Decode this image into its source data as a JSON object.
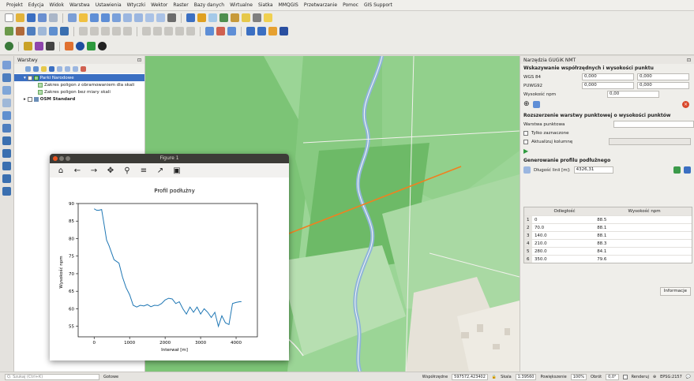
{
  "menubar": [
    "Projekt",
    "Edycja",
    "Widok",
    "Warstwa",
    "Ustawienia",
    "Wtyczki",
    "Wektor",
    "Raster",
    "Bazy danych",
    "Wirtualne",
    "Siatka",
    "MMQGIS",
    "Przetwarzanie",
    "Pomoc",
    "GIS Support"
  ],
  "layers_panel": {
    "title": "Warstwy",
    "items": [
      {
        "label": "Parki Narodowe",
        "selected": true
      },
      {
        "label": "Zakres poligon z obramowaniem dla skali",
        "selected": false
      },
      {
        "label": "Zakres poligon bez miary skali",
        "selected": false
      },
      {
        "label": "OSM Standard",
        "selected": false
      }
    ]
  },
  "figure": {
    "title": "Figure 1",
    "toolbar_icons": [
      "home-icon",
      "back-icon",
      "forward-icon",
      "pan-icon",
      "zoom-icon",
      "configure-icon",
      "edit-axis-icon",
      "save-icon"
    ]
  },
  "chart_data": {
    "type": "line",
    "title": "Profil podłużny",
    "xlabel": "Interwał [m]",
    "ylabel": "Wysokość npm",
    "xlim": [
      -450,
      4600
    ],
    "ylim": [
      52,
      90
    ],
    "xticks": [
      0,
      1000,
      2000,
      3000,
      4000
    ],
    "yticks": [
      55,
      60,
      65,
      70,
      75,
      80,
      85,
      90
    ],
    "series": [
      {
        "color": "#1f77b4",
        "x": [
          0,
          70,
          140,
          210,
          280,
          350,
          420,
          560,
          700,
          800,
          900,
          1000,
          1100,
          1200,
          1300,
          1400,
          1500,
          1600,
          1700,
          1800,
          1900,
          2000,
          2100,
          2200,
          2300,
          2400,
          2500,
          2600,
          2700,
          2800,
          2900,
          3000,
          3100,
          3200,
          3300,
          3400,
          3500,
          3600,
          3700,
          3800,
          3900,
          4000,
          4100,
          4150
        ],
        "y": [
          88.5,
          88.1,
          88.1,
          88.3,
          84.1,
          79.6,
          78.0,
          74.0,
          73.0,
          69.0,
          66.0,
          64.0,
          61.0,
          60.5,
          61.0,
          60.8,
          61.2,
          60.6,
          61.0,
          60.9,
          61.5,
          62.5,
          63.0,
          62.8,
          61.5,
          62.0,
          60.0,
          58.5,
          60.5,
          59.0,
          60.5,
          58.5,
          60.0,
          59.0,
          57.5,
          59.0,
          55.0,
          58.0,
          56.0,
          55.5,
          61.5,
          61.8,
          62.0,
          62.0
        ]
      }
    ]
  },
  "right_panel": {
    "title": "Narzędzia GUGiK NMT",
    "coords": {
      "title": "Wskazywanie współrzędnych i wysokości punktu",
      "rows": [
        {
          "label": "WGS 84",
          "v1": "0,000",
          "v2": "0,000"
        },
        {
          "label": "PUWG92",
          "v1": "0,000",
          "v2": "0,000"
        }
      ],
      "height_label": "Wysokość npm",
      "height_value": "0,00"
    },
    "extend": {
      "title": "Rozszerzenie warstwy punktowej o wysokości punktów",
      "layer_label": "Warstwa punktowa",
      "only_selected": "Tylko zaznaczone",
      "update_column": "Aktualizuj kolumnę"
    },
    "profile": {
      "title": "Generowanie profilu podłużnego",
      "length_label": "Długość linii [m]:",
      "length_value": "4326,31",
      "columns": [
        "Odległość",
        "Wysokość npm"
      ],
      "rows": [
        [
          "1",
          "0",
          "88.5"
        ],
        [
          "2",
          "70.0",
          "88.1"
        ],
        [
          "3",
          "140.0",
          "88.1"
        ],
        [
          "4",
          "210.0",
          "88.3"
        ],
        [
          "5",
          "280.0",
          "84.1"
        ],
        [
          "6",
          "350.0",
          "79.6"
        ]
      ],
      "info_button": "Informacje"
    }
  },
  "statusbar": {
    "search_placeholder": "Q. Szukaj (Ctrl+K)",
    "ready": "Gotowe",
    "coord_label": "Współrzędne",
    "coord_value": "597572,423402",
    "scale_label": "Skala",
    "scale_value": "1:39560",
    "magnifier_label": "Powiększenie",
    "magnifier_value": "100%",
    "rotation_label": "Obrót",
    "rotation_value": "0,0°",
    "render_label": "Renderuj",
    "crs": "EPSG:2157"
  }
}
